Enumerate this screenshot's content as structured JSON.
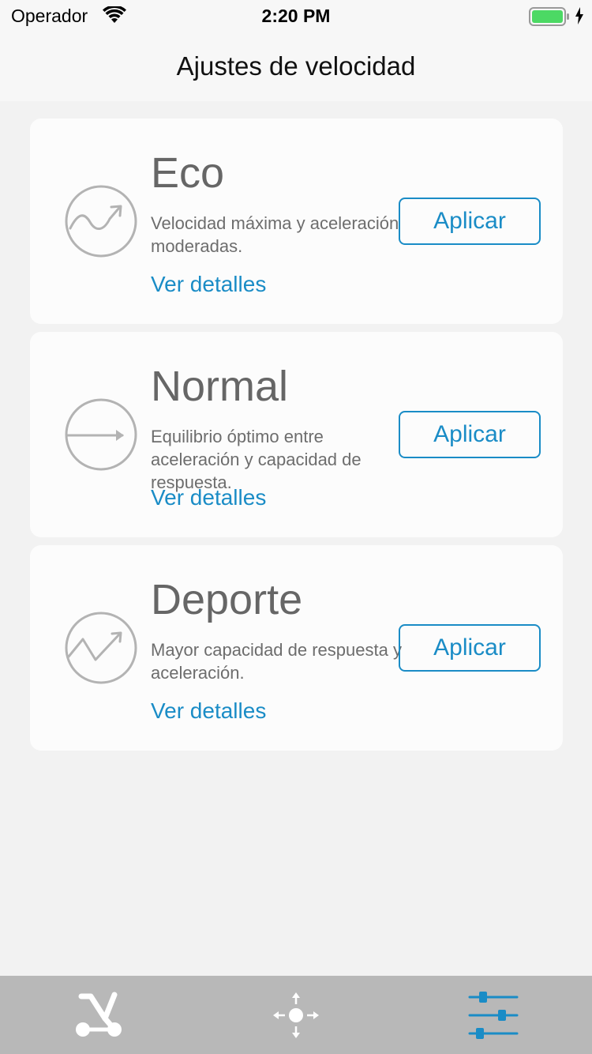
{
  "status_bar": {
    "carrier": "Operador",
    "time": "2:20 PM",
    "battery_color": "#4cd964"
  },
  "header": {
    "title": "Ajustes de velocidad"
  },
  "modes": [
    {
      "title": "Eco",
      "description": "Velocidad máxima y aceleración moderadas.",
      "details_label": "Ver detalles",
      "apply_label": "Aplicar",
      "icon": "wave-curve-icon"
    },
    {
      "title": "Normal",
      "description": "Equilibrio óptimo entre aceleración y capacidad de respuesta.",
      "details_label": "Ver detalles",
      "apply_label": "Aplicar",
      "icon": "straight-arrow-icon"
    },
    {
      "title": "Deporte",
      "description": "Mayor capacidad de respuesta y aceleración.",
      "details_label": "Ver detalles",
      "apply_label": "Aplicar",
      "icon": "zigzag-arrow-icon"
    }
  ],
  "tab_bar": {
    "tabs": [
      {
        "icon": "scooter-icon",
        "active": false
      },
      {
        "icon": "move-arrows-icon",
        "active": false
      },
      {
        "icon": "sliders-icon",
        "active": true
      }
    ]
  },
  "colors": {
    "accent": "#1a8cc6",
    "background": "#f2f2f2",
    "card": "#fcfcfc",
    "tab_bar": "#b8b8b8",
    "icon_gray": "#b0b0b0"
  }
}
